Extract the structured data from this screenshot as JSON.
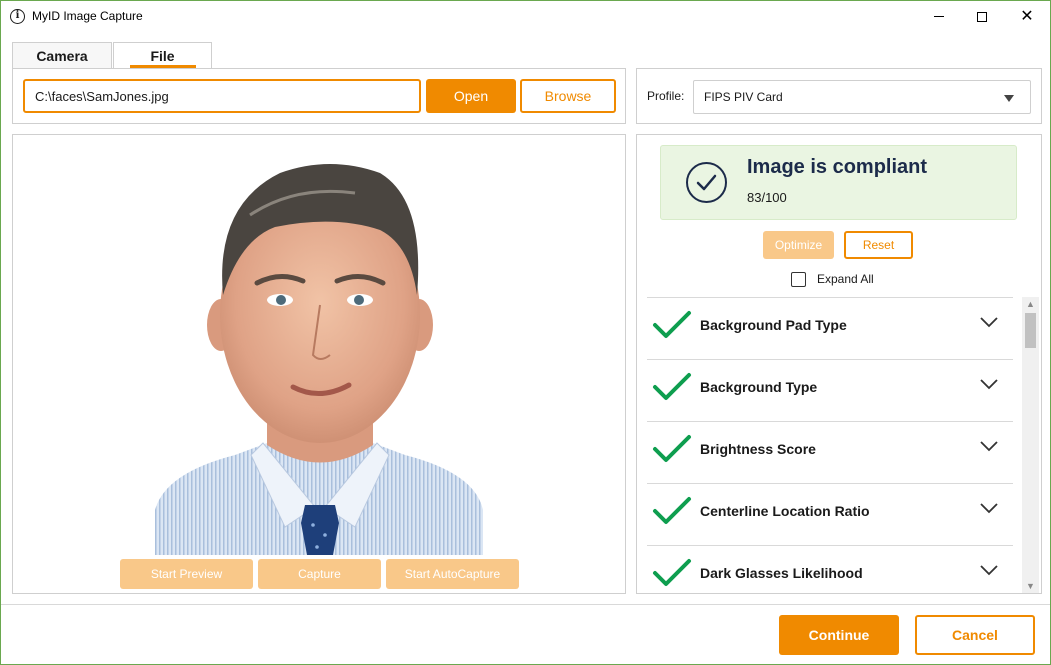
{
  "window": {
    "title": "MyID Image Capture",
    "app_icon": "info-icon",
    "controls": [
      "minimize-icon",
      "maximize-icon",
      "close-icon"
    ]
  },
  "tabs": [
    {
      "label": "Camera",
      "active": false
    },
    {
      "label": "File",
      "active": true
    }
  ],
  "file": {
    "path_value": "C:\\faces\\SamJones.jpg",
    "open_label": "Open",
    "browse_label": "Browse"
  },
  "profile": {
    "label": "Profile:",
    "selected": "FIPS PIV Card"
  },
  "capture_controls": {
    "start_preview": "Start Preview",
    "capture": "Capture",
    "start_autocapture": "Start AutoCapture"
  },
  "compliance": {
    "title": "Image is compliant",
    "score": "83/100",
    "optimize_label": "Optimize",
    "reset_label": "Reset",
    "expand_all_label": "Expand All",
    "expand_all_checked": false
  },
  "checks": [
    {
      "label": "Background Pad Type",
      "status": "pass"
    },
    {
      "label": "Background Type",
      "status": "pass"
    },
    {
      "label": "Brightness Score",
      "status": "pass"
    },
    {
      "label": "Centerline Location Ratio",
      "status": "pass"
    },
    {
      "label": "Dark Glasses Likelihood",
      "status": "pass"
    }
  ],
  "footer": {
    "continue_label": "Continue",
    "cancel_label": "Cancel"
  },
  "colors": {
    "accent": "#f08a00",
    "accent_disabled": "#f9c889",
    "pass_green": "#0e9e4f",
    "compliant_bg": "#eaf5e2",
    "navy": "#1c2b4a"
  }
}
